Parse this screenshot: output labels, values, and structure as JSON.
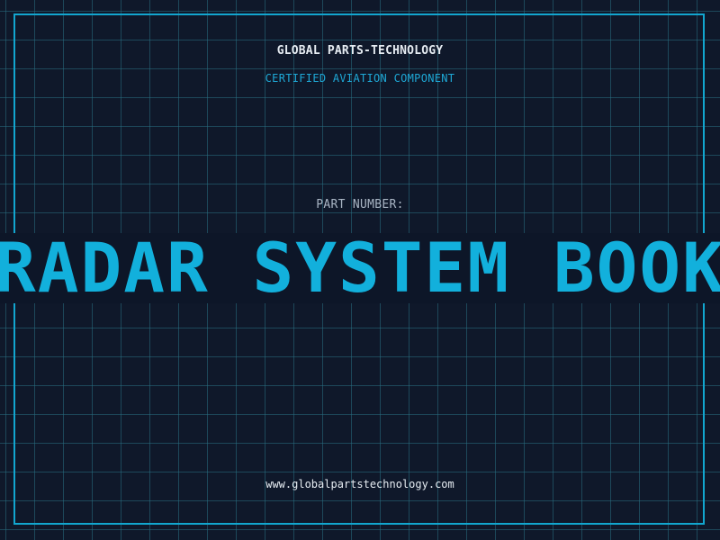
{
  "header": {
    "brand": "GLOBAL PARTS-TECHNOLOGY",
    "subtitle": "CERTIFIED AVIATION COMPONENT"
  },
  "part": {
    "label": "PART NUMBER:",
    "value": "RADAR SYSTEM BOOKS"
  },
  "footer": {
    "url": "www.globalpartstechnology.com"
  },
  "colors": {
    "background": "#0f182a",
    "accent": "#12b0dc",
    "frame": "#12a6cf",
    "text": "#e6ecf2",
    "muted": "#a9b5c4"
  }
}
